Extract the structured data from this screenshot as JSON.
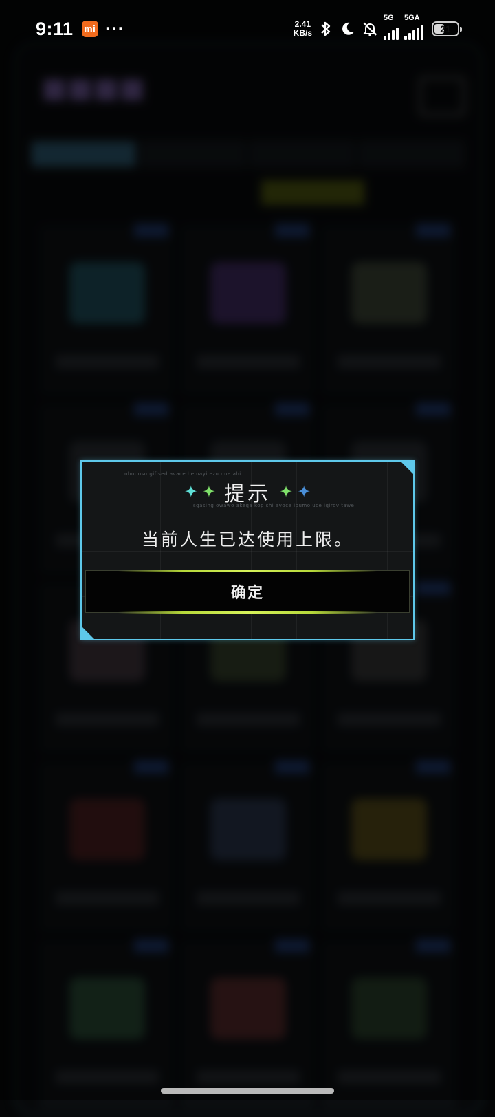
{
  "status_bar": {
    "time": "9:11",
    "notification_badge": "mi",
    "more_indicator": "···",
    "network_speed_value": "2.41",
    "network_speed_unit": "KB/s",
    "signal_1_label": "5G",
    "signal_2_label": "5GA",
    "battery_level": "21",
    "icons": [
      "bluetooth-icon",
      "moon-icon",
      "bell-off-icon"
    ]
  },
  "dialog": {
    "title": "提示",
    "message": "当前人生已达使用上限。",
    "confirm_label": "确定",
    "deco_line_1": "nhuposu giflsed avace hemayi ezu nue ahi",
    "deco_line_2": "sgasing owawo akeqa kop shi avoce ipumo uce iqirov tawe",
    "sparkle_colors": [
      "#5fe0d8",
      "#7fe06a",
      "#7fe06a",
      "#4a8fd8"
    ]
  },
  "colors": {
    "dialog_border": "#5ec8ea",
    "button_glow": "#b6d83a"
  }
}
